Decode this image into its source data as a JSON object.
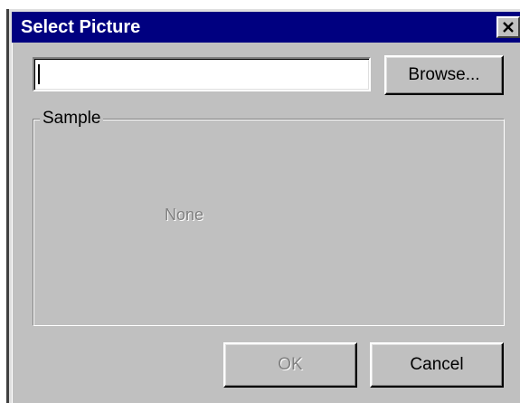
{
  "window": {
    "title": "Select Picture",
    "close_icon": "close-icon"
  },
  "path_field": {
    "value": ""
  },
  "buttons": {
    "browse_label": "Browse...",
    "ok_label": "OK",
    "cancel_label": "Cancel"
  },
  "sample": {
    "group_label": "Sample",
    "placeholder_text": "None"
  },
  "colors": {
    "titlebar": "#000080",
    "dialog_face": "#c0c0c0",
    "disabled_text": "#808080"
  }
}
